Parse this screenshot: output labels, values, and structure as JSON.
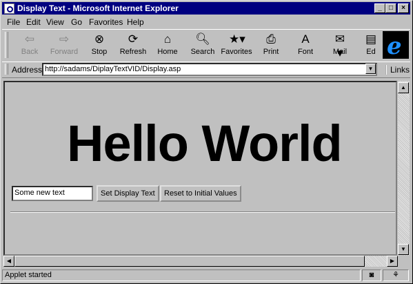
{
  "window": {
    "title": "Display Text - Microsoft Internet Explorer"
  },
  "menu": [
    "File",
    "Edit",
    "View",
    "Go",
    "Favorites",
    "Help"
  ],
  "toolbar": {
    "back": "Back",
    "forward": "Forward",
    "stop": "Stop",
    "refresh": "Refresh",
    "home": "Home",
    "search": "Search",
    "favorites": "Favorites",
    "print": "Print",
    "font": "Font",
    "mail": "Mail",
    "edit": "Ed"
  },
  "address": {
    "label": "Address",
    "url": "http://sadams/DiplayTextVID/Display.asp",
    "links": "Links"
  },
  "content": {
    "heading": "Hello World",
    "input_value": "Some new text",
    "set_button": "Set Display Text",
    "reset_button": "Reset to Initial Values"
  },
  "status": {
    "text": "Applet started"
  },
  "icons": {
    "back": "left-arrow-icon",
    "forward": "right-arrow-icon",
    "stop": "stop-icon",
    "refresh": "refresh-icon",
    "home": "home-icon",
    "search": "search-icon",
    "favorites": "favorites-icon",
    "print": "printer-icon",
    "font": "font-icon",
    "mail": "mail-icon"
  }
}
